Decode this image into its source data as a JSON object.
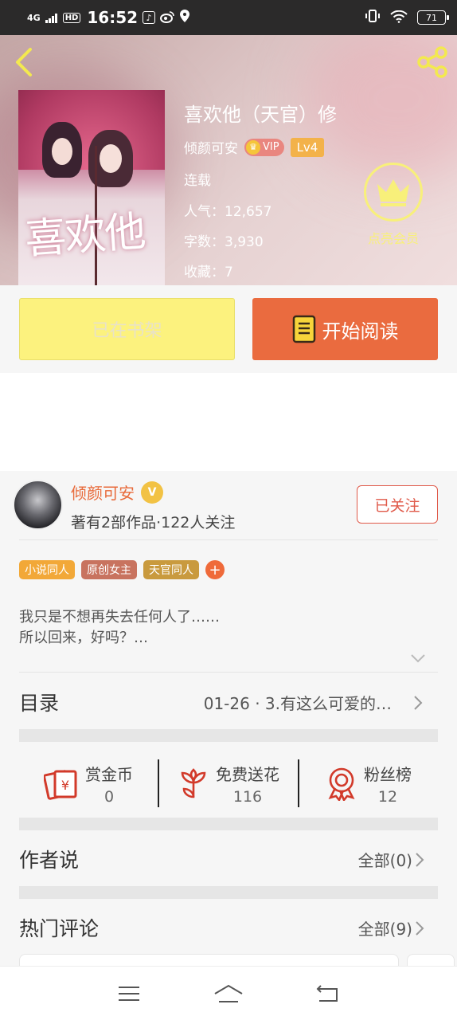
{
  "status_bar": {
    "network": "4G",
    "hd": "HD",
    "time": "16:52",
    "battery": "71"
  },
  "book": {
    "title": "喜欢他（天官）修",
    "author": "倾颜可安",
    "vip_label": "VIP",
    "level": "Lv4",
    "status": "连载",
    "popularity": "人气：12,657",
    "word_count": "字数：3,930",
    "favorites": "收藏：7",
    "cover_text": "喜欢他"
  },
  "member": {
    "label": "点亮会员"
  },
  "actions": {
    "shelf_label": "已在书架",
    "read_label": "开始阅读"
  },
  "author_card": {
    "name": "倾颜可安",
    "v_badge": "V",
    "stats": "著有2部作品·122人关注",
    "follow_label": "已关注"
  },
  "tags": [
    {
      "label": "小说同人",
      "color": "#f2a838"
    },
    {
      "label": "原创女主",
      "color": "#c8735f"
    },
    {
      "label": "天官同人",
      "color": "#c99a3e"
    }
  ],
  "tag_add": "+",
  "intro": {
    "line1": "我只是不想再失去任何人了……",
    "line2": "所以回来，好吗？…"
  },
  "catalog": {
    "label": "目录",
    "latest": "01-26 · 3.有这么可爱的…"
  },
  "stats": [
    {
      "label": "赏金币",
      "value": "0",
      "icon": "reward-envelope-icon"
    },
    {
      "label": "免费送花",
      "value": "116",
      "icon": "flower-icon"
    },
    {
      "label": "粉丝榜",
      "value": "12",
      "icon": "medal-icon"
    }
  ],
  "author_says": {
    "label": "作者说",
    "all": "全部(0)"
  },
  "hot_comments": {
    "label": "热门评论",
    "all": "全部(9)"
  },
  "colors": {
    "accent_orange": "#ea6b3f",
    "shelf_yellow": "#fcf27e",
    "member_yellow": "#f8f07a",
    "follow_red": "#e05a4a"
  }
}
